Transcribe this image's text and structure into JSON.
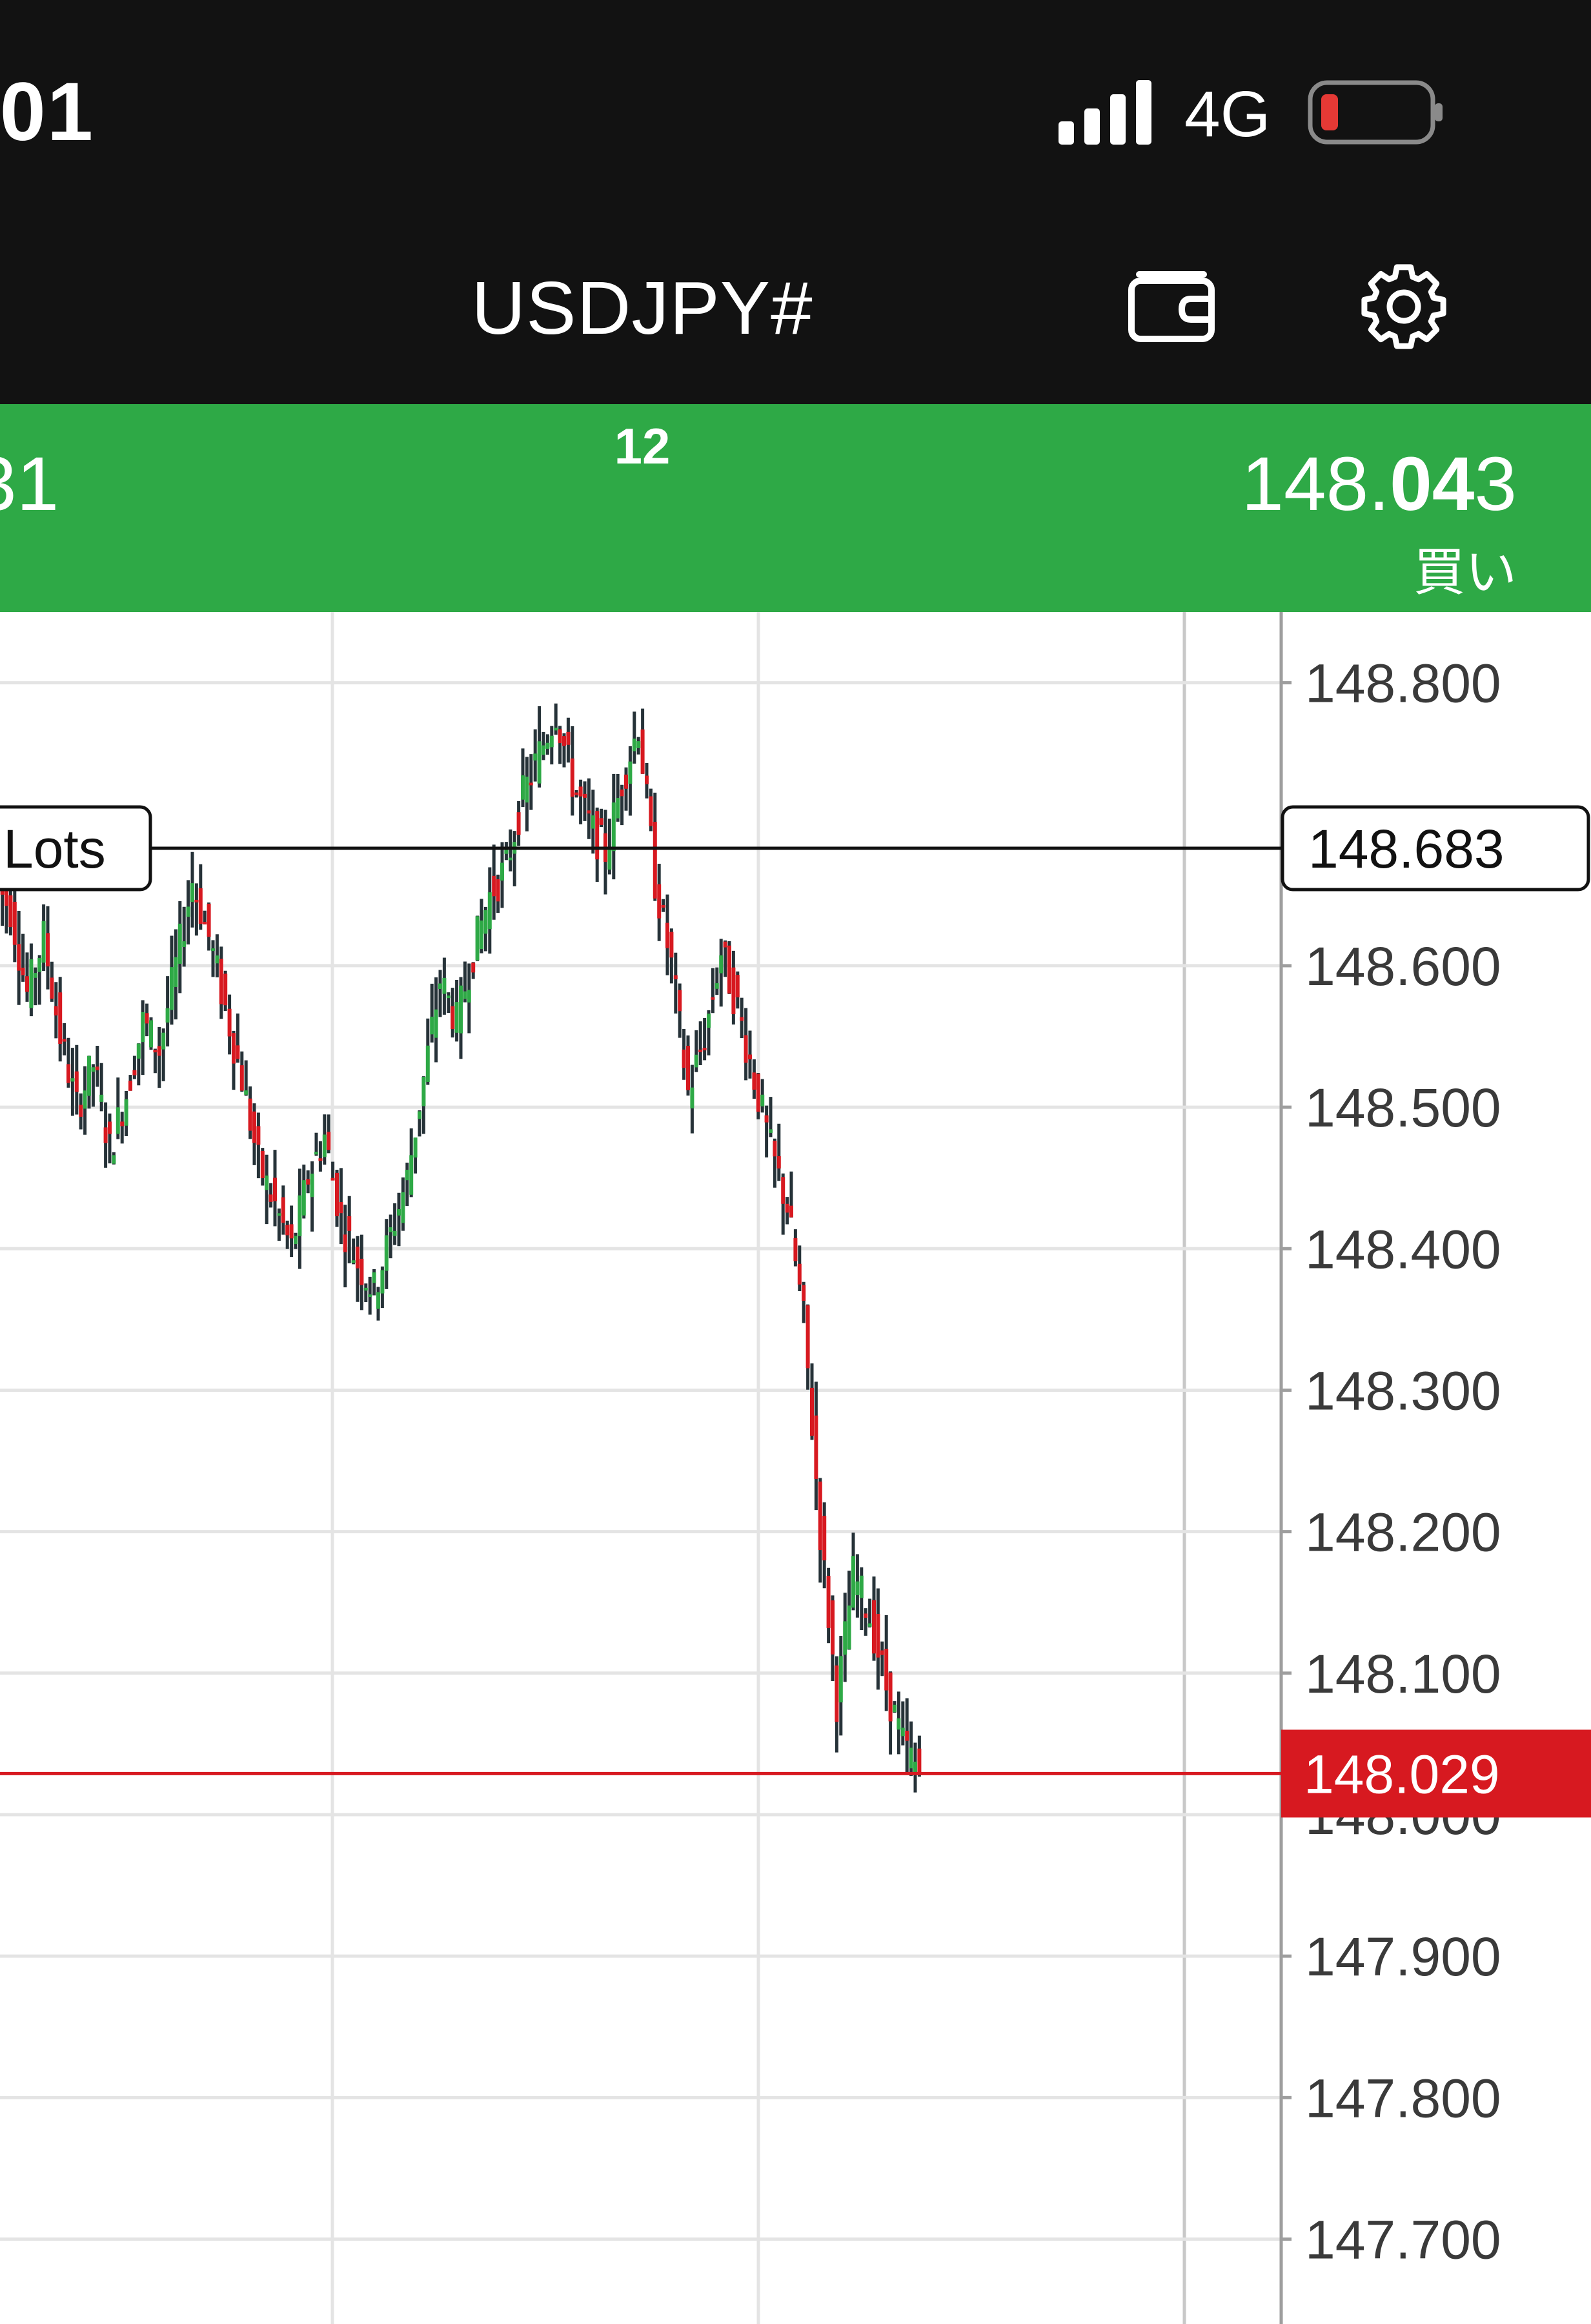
{
  "status_bar": {
    "time": ":01",
    "network": "4G",
    "battery_color": "#e53935"
  },
  "header": {
    "symbol": "USDJPY#",
    "wallet_icon": "wallet-icon",
    "settings_icon": "gear-icon"
  },
  "quote_bar": {
    "sell_price_partial": "31",
    "spread": "12",
    "buy_price_prefix": "148.",
    "buy_price_big": "04",
    "buy_price_suffix": "3",
    "buy_label": "買い",
    "bg_color": "#2ea946"
  },
  "chart_data": {
    "type": "candlestick",
    "y_ticks": [
      "148.800",
      "148.600",
      "148.500",
      "148.400",
      "148.300",
      "148.200",
      "148.100",
      "148.000",
      "147.900",
      "147.800",
      "147.700"
    ],
    "ylim": [
      147.64,
      148.85
    ],
    "order_line": {
      "label": "Lots",
      "price": "148.683"
    },
    "current_price": {
      "price": "148.029",
      "color": "#d71920"
    },
    "up_color": "#2ea946",
    "down_color": "#d71920",
    "wick_color": "#263238",
    "closes": [
      148.64,
      148.58,
      148.62,
      148.55,
      148.5,
      148.53,
      148.47,
      148.51,
      148.56,
      148.54,
      148.6,
      148.66,
      148.62,
      148.57,
      148.52,
      148.46,
      148.43,
      148.4,
      148.45,
      148.48,
      148.42,
      148.39,
      148.37,
      148.41,
      148.45,
      148.52,
      148.59,
      148.56,
      148.61,
      148.65,
      148.67,
      148.72,
      148.75,
      148.78,
      148.73,
      148.7,
      148.68,
      148.73,
      148.77,
      148.66,
      148.6,
      148.51,
      148.55,
      148.61,
      148.57,
      148.52,
      148.47,
      148.43,
      148.35,
      148.2,
      148.08,
      148.17,
      148.14,
      148.09,
      148.05,
      148.03
    ]
  }
}
